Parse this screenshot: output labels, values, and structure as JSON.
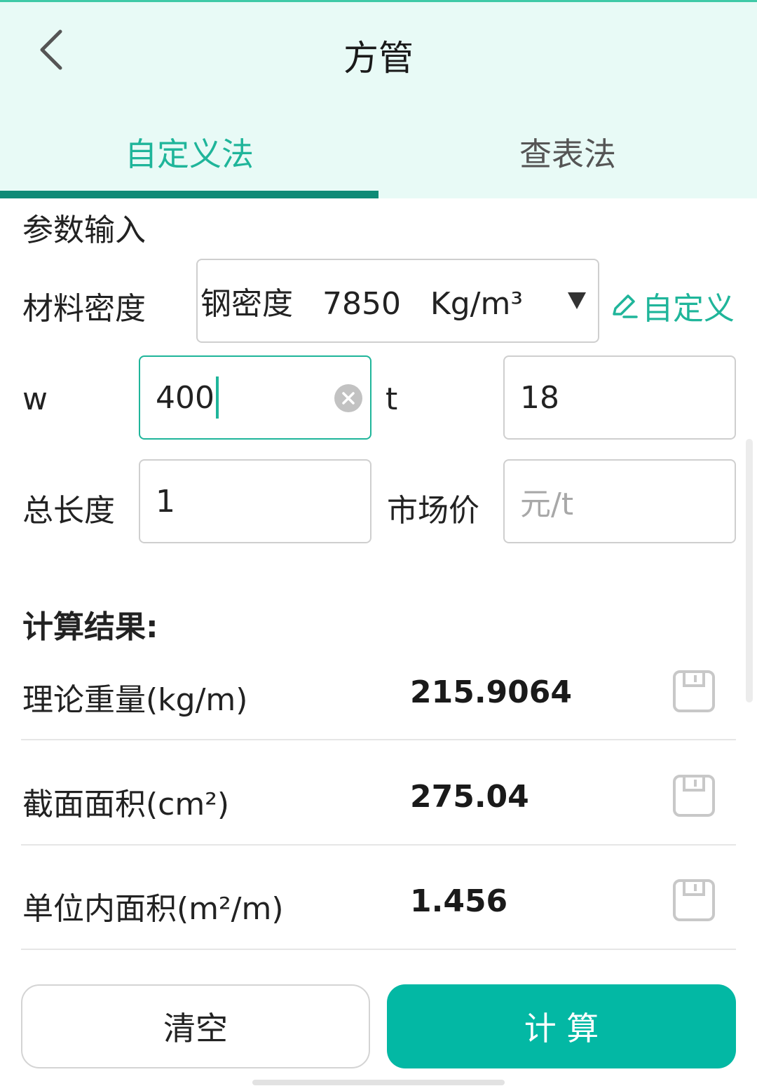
{
  "header": {
    "title": "方管"
  },
  "tabs": [
    {
      "label": "自定义法",
      "active": true
    },
    {
      "label": "查表法",
      "active": false
    }
  ],
  "params": {
    "section_title": "参数输入",
    "density": {
      "label": "材料密度",
      "value": "钢密度   7850   Kg/m³",
      "custom_label": "自定义"
    },
    "w": {
      "label": "w",
      "value": "400"
    },
    "t": {
      "label": "t",
      "value": "18"
    },
    "length": {
      "label": "总长度",
      "value": "1"
    },
    "price": {
      "label": "市场价",
      "placeholder": "元/t"
    }
  },
  "results": {
    "title": "计算结果:",
    "items": [
      {
        "label": "理论重量(kg/m)",
        "value": "215.9064"
      },
      {
        "label": "截面面积(cm²)",
        "value": "275.04"
      },
      {
        "label": "单位内面积(m²/m)",
        "value": "1.456"
      }
    ]
  },
  "buttons": {
    "clear": "清空",
    "calculate": "计 算"
  },
  "colors": {
    "accent": "#1fb59a",
    "header_bg": "#e8faf6",
    "tab_indicator": "#0e8a76",
    "calc_button": "#03b8a4"
  },
  "icons": {
    "back": "chevron-left-icon",
    "dropdown": "triangle-down-icon",
    "edit": "edit-icon",
    "clear": "clear-circle-icon",
    "save": "save-icon"
  }
}
